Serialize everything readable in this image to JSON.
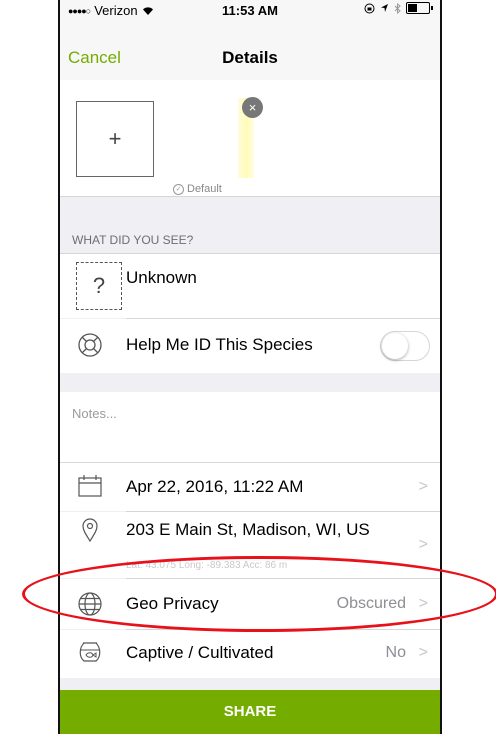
{
  "status_bar": {
    "signal": "●●●●○",
    "carrier": "Verizon",
    "time": "11:53 AM"
  },
  "nav": {
    "cancel_label": "Cancel",
    "title": "Details"
  },
  "photos": {
    "add_label": "+",
    "remove_label": "×",
    "default_label": "Default"
  },
  "species_section": {
    "header": "WHAT DID YOU SEE?",
    "species_name": "Unknown",
    "unknown_icon_glyph": "?",
    "help_id_label": "Help Me ID This Species",
    "help_id_enabled": false
  },
  "notes": {
    "placeholder": "Notes..."
  },
  "details": {
    "date_label": "Apr 22, 2016, 11:22 AM",
    "location_label": "203 E Main St, Madison, WI, US",
    "location_sub": "Lat: 43.075  Long: -89.383  Acc: 86 m",
    "geo_privacy_label": "Geo Privacy",
    "geo_privacy_value": "Obscured",
    "captive_label": "Captive / Cultivated",
    "captive_value": "No",
    "chevron": ">"
  },
  "share_button": {
    "label": "SHARE"
  },
  "colors": {
    "accent": "#74ac00",
    "highlight": "#e8111a"
  },
  "icons": [
    "wifi-icon",
    "location-arrow-icon",
    "bluetooth-icon",
    "battery-icon",
    "calendar-icon",
    "location-pin-icon",
    "globe-icon",
    "lifebuoy-icon",
    "fishbowl-icon",
    "checkmark-circle-icon"
  ]
}
